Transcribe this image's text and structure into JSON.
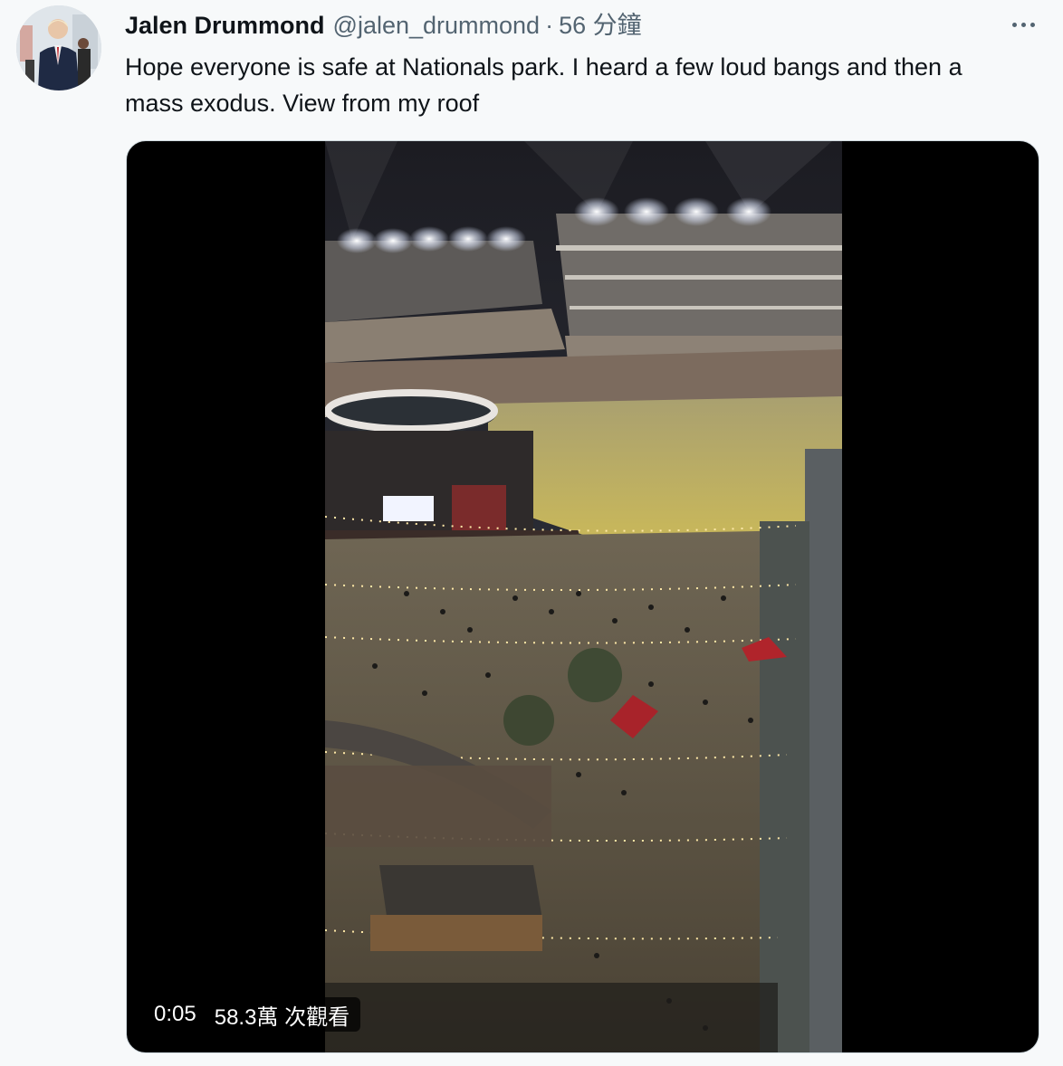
{
  "tweet": {
    "display_name": "Jalen Drummond",
    "handle": "@jalen_drummond",
    "separator": "·",
    "time": "56 分鐘",
    "text": "Hope everyone is safe at Nationals park. I heard a few loud bangs and then a mass exodus. View from my roof"
  },
  "icons": {
    "more": "more-horizontal-icon"
  },
  "video": {
    "time": "0:05",
    "views": "58.3萬 次觀看"
  },
  "colors": {
    "background": "#f7f9fa",
    "text": "#0f1419",
    "secondary_text": "#536471"
  }
}
